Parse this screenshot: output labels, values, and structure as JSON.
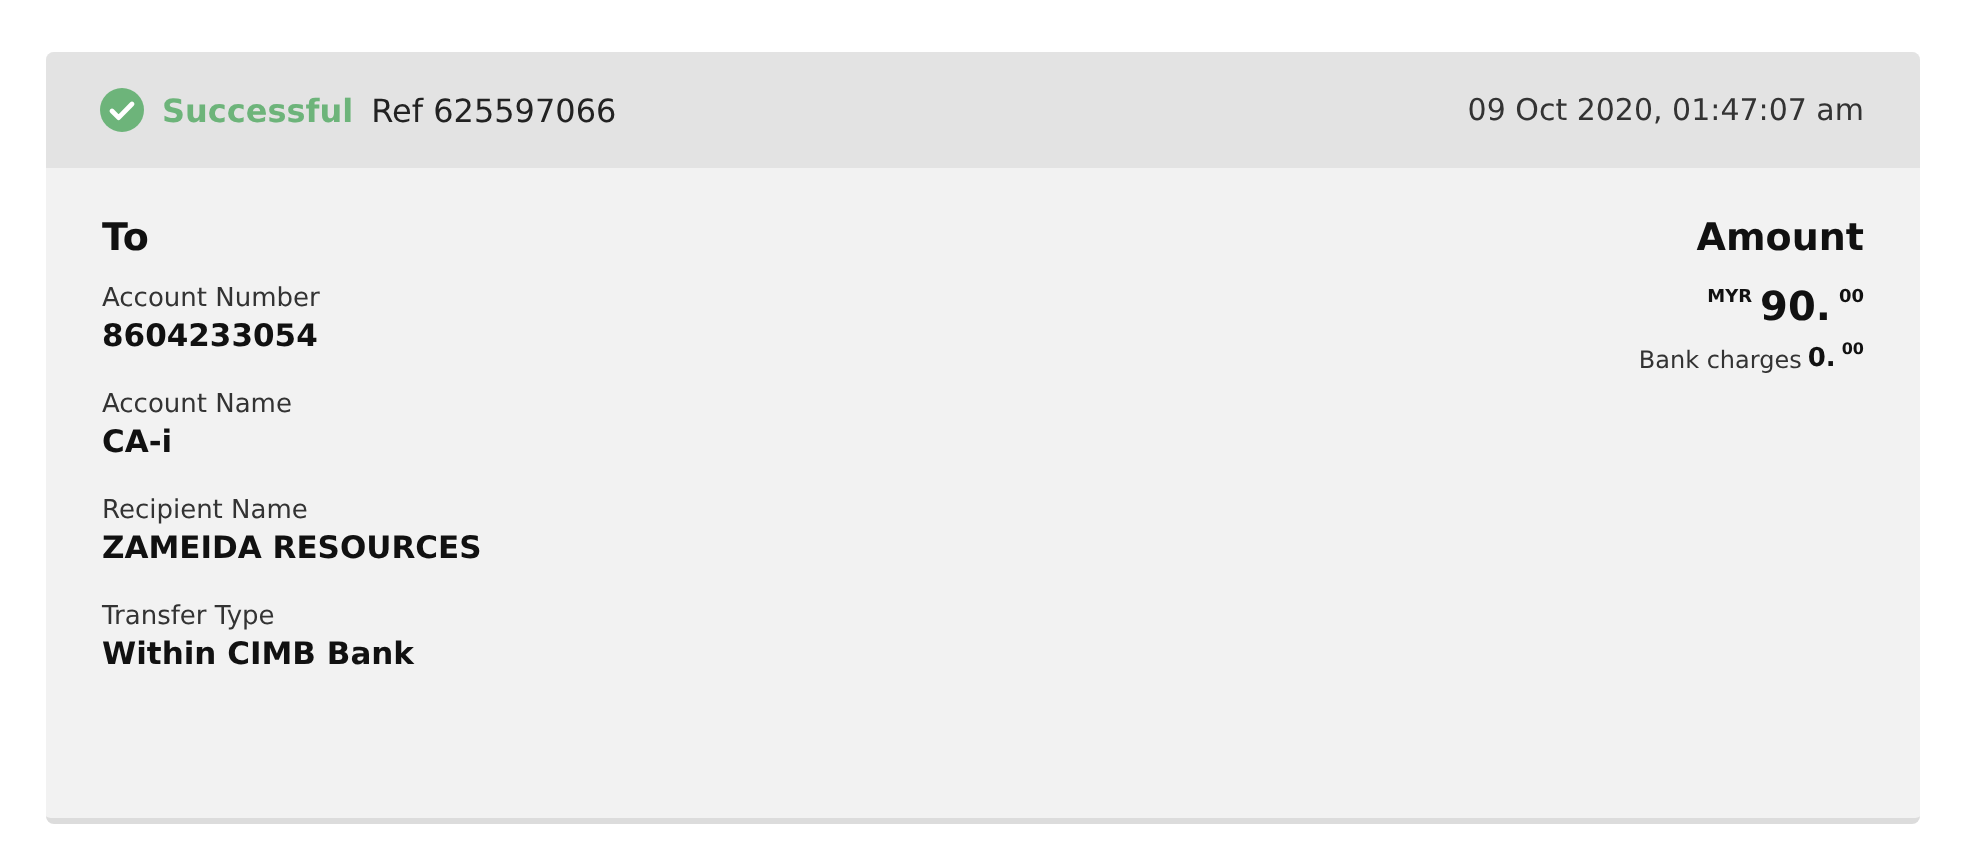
{
  "header": {
    "status": {
      "kind": "success",
      "label": "Successful"
    },
    "reference": "Ref 625597066",
    "timestamp": "09 Oct 2020, 01:47:07 am"
  },
  "recipient": {
    "title": "To",
    "fields": [
      {
        "label": "Account Number",
        "value": "8604233054"
      },
      {
        "label": "Account Name",
        "value": "CA-i"
      },
      {
        "label": "Recipient Name",
        "value": "ZAMEIDA RESOURCES"
      },
      {
        "label": "Transfer Type",
        "value": "Within CIMB Bank"
      }
    ]
  },
  "amount": {
    "title": "Amount",
    "currency": "MYR",
    "whole": "90.",
    "cents": "00",
    "charges_label": "Bank charges",
    "charges_whole": "0.",
    "charges_cents": "00"
  }
}
